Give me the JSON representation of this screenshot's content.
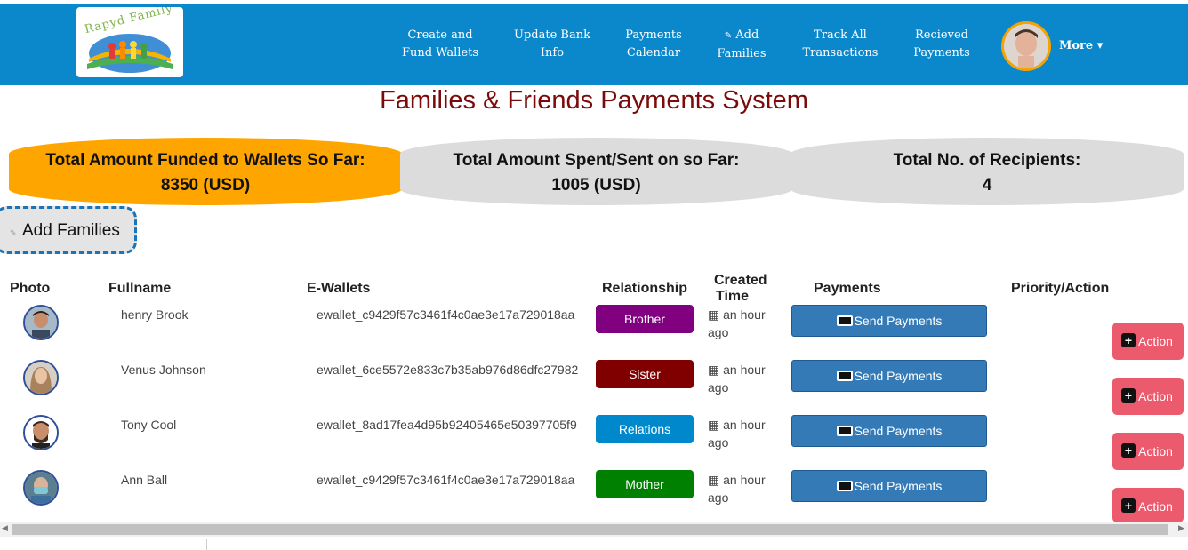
{
  "app": {
    "logo_text": "Rapyd Family",
    "page_title": "Families & Friends Payments System"
  },
  "nav": {
    "items": [
      {
        "line1": "Create and",
        "line2": "Fund Wallets"
      },
      {
        "line1": "Update Bank",
        "line2": "Info"
      },
      {
        "line1": "Payments",
        "line2": "Calendar"
      },
      {
        "line1": "Add",
        "line2": "Families"
      },
      {
        "line1": "Track All",
        "line2": "Transactions"
      },
      {
        "line1": "Recieved",
        "line2": "Payments"
      }
    ],
    "more_label": "More ▾"
  },
  "stats": [
    {
      "label": "Total Amount Funded to Wallets So Far:",
      "value": "8350 (USD)"
    },
    {
      "label": "Total Amount Spent/Sent on so Far:",
      "value": "1005 (USD)"
    },
    {
      "label": "Total No. of Recipients:",
      "value": "4"
    }
  ],
  "add_families_label": "Add Families",
  "table": {
    "headers": {
      "photo": "Photo",
      "fullname": "Fullname",
      "ewallets": "E-Wallets",
      "relationship": "Relationship",
      "created_line1": "Created",
      "created_line2": "Time",
      "payments": "Payments",
      "priority": "Priority/Action"
    },
    "rows": [
      {
        "name": "henry Brook",
        "wallet": "ewallet_c9429f57c3461f4c0ae3e17a729018aa",
        "relationship": "Brother",
        "time_line1": "an hour",
        "time_line2": "ago",
        "send_label": "Send Payments",
        "action_label": "Action"
      },
      {
        "name": "Venus Johnson",
        "wallet": "ewallet_6ce5572e833c7b35ab976d86dfc27982",
        "relationship": "Sister",
        "time_line1": "an hour",
        "time_line2": "ago",
        "send_label": "Send Payments",
        "action_label": "Action"
      },
      {
        "name": "Tony Cool",
        "wallet": "ewallet_8ad17fea4d95b92405465e50397705f9",
        "relationship": "Relations",
        "time_line1": "an hour",
        "time_line2": "ago",
        "send_label": "Send Payments",
        "action_label": "Action"
      },
      {
        "name": "Ann Ball",
        "wallet": "ewallet_c9429f57c3461f4c0ae3e17a729018aa",
        "relationship": "Mother",
        "time_line1": "an hour",
        "time_line2": "ago",
        "send_label": "Send Payments",
        "action_label": "Action"
      }
    ]
  },
  "colors": {
    "navbar": "#0b87cc",
    "title": "#7b0b0b",
    "stat_highlight": "#ffa500",
    "stat_default": "#dcdcdc",
    "brother": "#800080",
    "sister": "#800000",
    "relations": "#0088cc",
    "mother": "#008000",
    "send_button": "#337ab7",
    "action_button": "#ec5a6e"
  },
  "icons": {
    "pencil": "edit-icon",
    "calendar": "calendar-icon",
    "money": "money-icon",
    "plus": "plus-square-icon",
    "caret": "caret-down-icon"
  }
}
